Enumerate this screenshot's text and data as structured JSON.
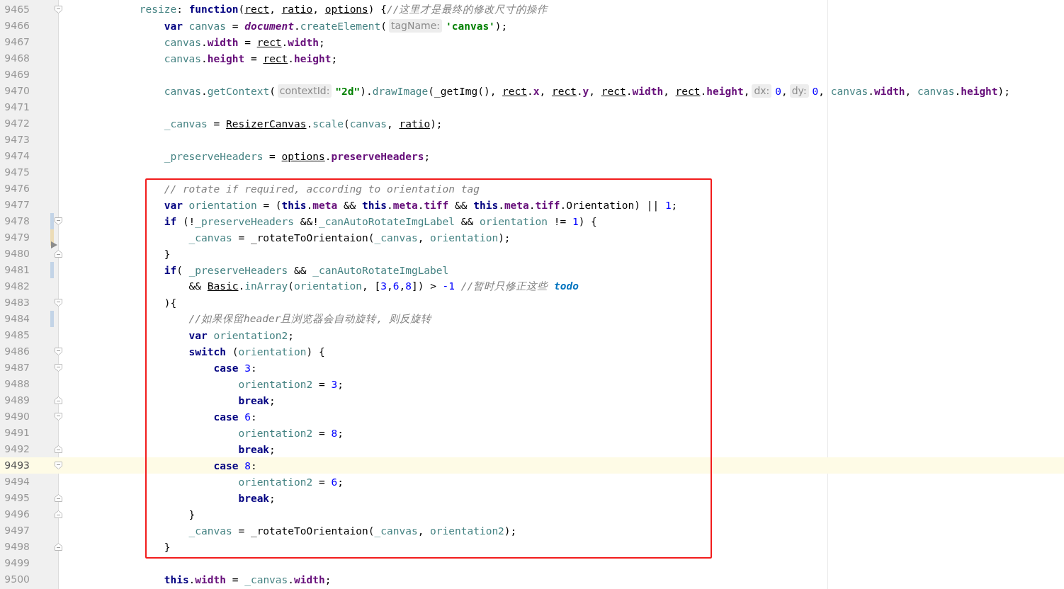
{
  "blocks": [
    {
      "kind": "plain",
      "lines": [
        {
          "number": "9465",
          "current": false,
          "marks": [
            {
              "kind": "fold_start"
            }
          ],
          "tokens": [
            {
              "kind": "field",
              "text": "            resize"
            },
            {
              "kind": "plain",
              "text": ": "
            },
            {
              "kind": "kw",
              "text": "function"
            },
            {
              "kind": "plain",
              "text": "("
            },
            {
              "kind": "ref",
              "text": "rect"
            },
            {
              "kind": "plain",
              "text": ", "
            },
            {
              "kind": "ref",
              "text": "ratio"
            },
            {
              "kind": "plain",
              "text": ", "
            },
            {
              "kind": "ref",
              "text": "options"
            },
            {
              "kind": "plain",
              "text": ") {"
            },
            {
              "kind": "comment",
              "text": "//这里才是最终的修改尺寸的操作"
            }
          ]
        },
        {
          "number": "9466",
          "current": false,
          "tokens": [
            {
              "kind": "kw",
              "text": "                var"
            },
            {
              "kind": "field",
              "text": " canvas"
            },
            {
              "kind": "plain",
              "text": " = "
            },
            {
              "kind": "global",
              "text": "document"
            },
            {
              "kind": "plain",
              "text": "."
            },
            {
              "kind": "field",
              "text": "createElement"
            },
            {
              "kind": "plain",
              "text": "("
            },
            {
              "kind": "hint",
              "text": "tagName:"
            },
            {
              "kind": "str",
              "text": "'canvas'"
            },
            {
              "kind": "plain",
              "text": ");"
            }
          ]
        },
        {
          "number": "9467",
          "current": false,
          "tokens": [
            {
              "kind": "field",
              "text": "                canvas"
            },
            {
              "kind": "plain",
              "text": "."
            },
            {
              "kind": "prop",
              "text": "width"
            },
            {
              "kind": "plain",
              "text": " = "
            },
            {
              "kind": "ref",
              "text": "rect"
            },
            {
              "kind": "plain",
              "text": "."
            },
            {
              "kind": "prop",
              "text": "width"
            },
            {
              "kind": "plain",
              "text": ";"
            }
          ]
        },
        {
          "number": "9468",
          "current": false,
          "tokens": [
            {
              "kind": "field",
              "text": "                canvas"
            },
            {
              "kind": "plain",
              "text": "."
            },
            {
              "kind": "prop",
              "text": "height"
            },
            {
              "kind": "plain",
              "text": " = "
            },
            {
              "kind": "ref",
              "text": "rect"
            },
            {
              "kind": "plain",
              "text": "."
            },
            {
              "kind": "prop",
              "text": "height"
            },
            {
              "kind": "plain",
              "text": ";"
            }
          ]
        },
        {
          "number": "9469",
          "current": false
        },
        {
          "number": "9470",
          "current": false,
          "tokens": [
            {
              "kind": "field",
              "text": "                canvas"
            },
            {
              "kind": "plain",
              "text": "."
            },
            {
              "kind": "field",
              "text": "getContext"
            },
            {
              "kind": "plain",
              "text": "("
            },
            {
              "kind": "hint",
              "text": "contextId:"
            },
            {
              "kind": "str",
              "text": "\"2d\""
            },
            {
              "kind": "plain",
              "text": ")."
            },
            {
              "kind": "field",
              "text": "drawImage"
            },
            {
              "kind": "plain",
              "text": "(_getImg(), "
            },
            {
              "kind": "ref",
              "text": "rect"
            },
            {
              "kind": "plain",
              "text": "."
            },
            {
              "kind": "prop",
              "text": "x"
            },
            {
              "kind": "plain",
              "text": ", "
            },
            {
              "kind": "ref",
              "text": "rect"
            },
            {
              "kind": "plain",
              "text": "."
            },
            {
              "kind": "prop",
              "text": "y"
            },
            {
              "kind": "plain",
              "text": ", "
            },
            {
              "kind": "ref",
              "text": "rect"
            },
            {
              "kind": "plain",
              "text": "."
            },
            {
              "kind": "prop",
              "text": "width"
            },
            {
              "kind": "plain",
              "text": ", "
            },
            {
              "kind": "ref",
              "text": "rect"
            },
            {
              "kind": "plain",
              "text": "."
            },
            {
              "kind": "prop",
              "text": "height"
            },
            {
              "kind": "plain",
              "text": ","
            },
            {
              "kind": "hint",
              "text": "dx:"
            },
            {
              "kind": "num",
              "text": "0"
            },
            {
              "kind": "plain",
              "text": ","
            },
            {
              "kind": "hint",
              "text": "dy:"
            },
            {
              "kind": "num",
              "text": "0"
            },
            {
              "kind": "plain",
              "text": ", "
            },
            {
              "kind": "field",
              "text": "canvas"
            },
            {
              "kind": "plain",
              "text": "."
            },
            {
              "kind": "prop",
              "text": "width"
            },
            {
              "kind": "plain",
              "text": ", "
            },
            {
              "kind": "field",
              "text": "canvas"
            },
            {
              "kind": "plain",
              "text": "."
            },
            {
              "kind": "prop",
              "text": "height"
            },
            {
              "kind": "plain",
              "text": ");"
            }
          ]
        },
        {
          "number": "9471",
          "current": false
        },
        {
          "number": "9472",
          "current": false,
          "tokens": [
            {
              "kind": "field",
              "text": "                _canvas"
            },
            {
              "kind": "plain",
              "text": " = "
            },
            {
              "kind": "ref",
              "text": "ResizerCanvas"
            },
            {
              "kind": "plain",
              "text": "."
            },
            {
              "kind": "field",
              "text": "scale"
            },
            {
              "kind": "plain",
              "text": "("
            },
            {
              "kind": "field",
              "text": "canvas"
            },
            {
              "kind": "plain",
              "text": ", "
            },
            {
              "kind": "ref",
              "text": "ratio"
            },
            {
              "kind": "plain",
              "text": ");"
            }
          ]
        },
        {
          "number": "9473",
          "current": false
        },
        {
          "number": "9474",
          "current": false,
          "tokens": [
            {
              "kind": "field",
              "text": "                _preserveHeaders"
            },
            {
              "kind": "plain",
              "text": " = "
            },
            {
              "kind": "ref",
              "text": "options"
            },
            {
              "kind": "plain",
              "text": "."
            },
            {
              "kind": "prop",
              "text": "preserveHeaders"
            },
            {
              "kind": "plain",
              "text": ";"
            }
          ]
        },
        {
          "number": "9475",
          "current": false
        }
      ]
    },
    {
      "kind": "boxed",
      "lines": [
        {
          "number": "9476",
          "current": false,
          "tokens": [
            {
              "kind": "comment",
              "text": "                // rotate if required, according to orientation tag"
            }
          ]
        },
        {
          "number": "9477",
          "current": false,
          "tokens": [
            {
              "kind": "kw",
              "text": "                var"
            },
            {
              "kind": "field",
              "text": " orientation"
            },
            {
              "kind": "plain",
              "text": " = ("
            },
            {
              "kind": "kw",
              "text": "this"
            },
            {
              "kind": "plain",
              "text": "."
            },
            {
              "kind": "prop",
              "text": "meta"
            },
            {
              "kind": "plain",
              "text": " && "
            },
            {
              "kind": "kw",
              "text": "this"
            },
            {
              "kind": "plain",
              "text": "."
            },
            {
              "kind": "prop",
              "text": "meta"
            },
            {
              "kind": "plain",
              "text": "."
            },
            {
              "kind": "prop",
              "text": "tiff"
            },
            {
              "kind": "plain",
              "text": " && "
            },
            {
              "kind": "kw",
              "text": "this"
            },
            {
              "kind": "plain",
              "text": "."
            },
            {
              "kind": "prop",
              "text": "meta"
            },
            {
              "kind": "plain",
              "text": "."
            },
            {
              "kind": "prop",
              "text": "tiff"
            },
            {
              "kind": "plain",
              "text": ".Orientation) || "
            },
            {
              "kind": "num",
              "text": "1"
            },
            {
              "kind": "plain",
              "text": ";"
            }
          ]
        },
        {
          "number": "9478",
          "current": false,
          "marks": [
            {
              "kind": "fold_start"
            },
            {
              "kind": "added"
            }
          ],
          "tokens": [
            {
              "kind": "kw",
              "text": "                if"
            },
            {
              "kind": "plain",
              "text": " (!"
            },
            {
              "kind": "field",
              "text": "_preserveHeaders"
            },
            {
              "kind": "plain",
              "text": " &&!"
            },
            {
              "kind": "field",
              "text": "_canAutoRotateImgLabel"
            },
            {
              "kind": "plain",
              "text": " && "
            },
            {
              "kind": "field",
              "text": "orientation"
            },
            {
              "kind": "plain",
              "text": " != "
            },
            {
              "kind": "num",
              "text": "1"
            },
            {
              "kind": "plain",
              "text": ") {"
            }
          ]
        },
        {
          "number": "9479",
          "current": false,
          "marks": [
            {
              "kind": "modified"
            }
          ],
          "tokens": [
            {
              "kind": "field",
              "text": "                    _canvas"
            },
            {
              "kind": "plain",
              "text": " = _rotateToOrientaion("
            },
            {
              "kind": "field",
              "text": "_canvas"
            },
            {
              "kind": "plain",
              "text": ", "
            },
            {
              "kind": "field",
              "text": "orientation"
            },
            {
              "kind": "plain",
              "text": ");"
            }
          ]
        },
        {
          "number": "9480",
          "current": false,
          "marks": [
            {
              "kind": "fold_end"
            },
            {
              "kind": "deleted"
            }
          ],
          "tokens": [
            {
              "kind": "plain",
              "text": "                }"
            }
          ]
        },
        {
          "number": "9481",
          "current": false,
          "marks": [
            {
              "kind": "added"
            }
          ],
          "tokens": [
            {
              "kind": "kw",
              "text": "                if"
            },
            {
              "kind": "plain",
              "text": "( "
            },
            {
              "kind": "field",
              "text": "_preserveHeaders"
            },
            {
              "kind": "plain",
              "text": " && "
            },
            {
              "kind": "field",
              "text": "_canAutoRotateImgLabel"
            }
          ]
        },
        {
          "number": "9482",
          "current": false,
          "tokens": [
            {
              "kind": "plain",
              "text": "                    && "
            },
            {
              "kind": "ref",
              "text": "Basic"
            },
            {
              "kind": "plain",
              "text": "."
            },
            {
              "kind": "field",
              "text": "inArray"
            },
            {
              "kind": "plain",
              "text": "("
            },
            {
              "kind": "field",
              "text": "orientation"
            },
            {
              "kind": "plain",
              "text": ", ["
            },
            {
              "kind": "num",
              "text": "3"
            },
            {
              "kind": "plain",
              "text": ","
            },
            {
              "kind": "num",
              "text": "6"
            },
            {
              "kind": "plain",
              "text": ","
            },
            {
              "kind": "num",
              "text": "8"
            },
            {
              "kind": "plain",
              "text": "]) > "
            },
            {
              "kind": "num",
              "text": "-1"
            },
            {
              "kind": "comment",
              "text": " //暂时只修正这些 "
            },
            {
              "kind": "todo",
              "text": "todo"
            }
          ]
        },
        {
          "number": "9483",
          "current": false,
          "marks": [
            {
              "kind": "fold_start"
            }
          ],
          "tokens": [
            {
              "kind": "plain",
              "text": "                ){"
            }
          ]
        },
        {
          "number": "9484",
          "current": false,
          "marks": [
            {
              "kind": "added"
            }
          ],
          "tokens": [
            {
              "kind": "comment",
              "text": "                    //如果保留header且浏览器会自动旋转, 则反旋转"
            }
          ]
        },
        {
          "number": "9485",
          "current": false,
          "tokens": [
            {
              "kind": "kw",
              "text": "                    var"
            },
            {
              "kind": "field",
              "text": " orientation2"
            },
            {
              "kind": "plain",
              "text": ";"
            }
          ]
        },
        {
          "number": "9486",
          "current": false,
          "marks": [
            {
              "kind": "fold_start"
            }
          ],
          "tokens": [
            {
              "kind": "kw",
              "text": "                    switch"
            },
            {
              "kind": "plain",
              "text": " ("
            },
            {
              "kind": "field",
              "text": "orientation"
            },
            {
              "kind": "plain",
              "text": ") {"
            }
          ]
        },
        {
          "number": "9487",
          "current": false,
          "marks": [
            {
              "kind": "fold_start"
            }
          ],
          "tokens": [
            {
              "kind": "kw",
              "text": "                        case"
            },
            {
              "kind": "num",
              "text": " 3"
            },
            {
              "kind": "plain",
              "text": ":"
            }
          ]
        },
        {
          "number": "9488",
          "current": false,
          "tokens": [
            {
              "kind": "field",
              "text": "                            orientation2"
            },
            {
              "kind": "plain",
              "text": " = "
            },
            {
              "kind": "num",
              "text": "3"
            },
            {
              "kind": "plain",
              "text": ";"
            }
          ]
        },
        {
          "number": "9489",
          "current": false,
          "marks": [
            {
              "kind": "fold_end"
            }
          ],
          "tokens": [
            {
              "kind": "kw",
              "text": "                            break"
            },
            {
              "kind": "plain",
              "text": ";"
            }
          ]
        },
        {
          "number": "9490",
          "current": false,
          "marks": [
            {
              "kind": "fold_start"
            }
          ],
          "tokens": [
            {
              "kind": "kw",
              "text": "                        case"
            },
            {
              "kind": "num",
              "text": " 6"
            },
            {
              "kind": "plain",
              "text": ":"
            }
          ]
        },
        {
          "number": "9491",
          "current": false,
          "tokens": [
            {
              "kind": "field",
              "text": "                            orientation2"
            },
            {
              "kind": "plain",
              "text": " = "
            },
            {
              "kind": "num",
              "text": "8"
            },
            {
              "kind": "plain",
              "text": ";"
            }
          ]
        },
        {
          "number": "9492",
          "current": false,
          "marks": [
            {
              "kind": "fold_end"
            }
          ],
          "tokens": [
            {
              "kind": "kw",
              "text": "                            break"
            },
            {
              "kind": "plain",
              "text": ";"
            }
          ]
        },
        {
          "number": "9493",
          "current": true,
          "marks": [
            {
              "kind": "fold_start"
            }
          ],
          "tokens": [
            {
              "kind": "kw",
              "text": "                        case"
            },
            {
              "kind": "num",
              "text": " 8"
            },
            {
              "kind": "plain",
              "text": ":"
            }
          ]
        },
        {
          "number": "9494",
          "current": false,
          "tokens": [
            {
              "kind": "field",
              "text": "                            orientation2"
            },
            {
              "kind": "plain",
              "text": " = "
            },
            {
              "kind": "num",
              "text": "6"
            },
            {
              "kind": "plain",
              "text": ";"
            }
          ]
        },
        {
          "number": "9495",
          "current": false,
          "marks": [
            {
              "kind": "fold_end"
            }
          ],
          "tokens": [
            {
              "kind": "kw",
              "text": "                            break"
            },
            {
              "kind": "plain",
              "text": ";"
            }
          ]
        },
        {
          "number": "9496",
          "current": false,
          "marks": [
            {
              "kind": "fold_end"
            }
          ],
          "tokens": [
            {
              "kind": "plain",
              "text": "                    }"
            }
          ]
        },
        {
          "number": "9497",
          "current": false,
          "tokens": [
            {
              "kind": "field",
              "text": "                    _canvas"
            },
            {
              "kind": "plain",
              "text": " = _rotateToOrientaion("
            },
            {
              "kind": "field",
              "text": "_canvas"
            },
            {
              "kind": "plain",
              "text": ", "
            },
            {
              "kind": "field",
              "text": "orientation2"
            },
            {
              "kind": "plain",
              "text": ");"
            }
          ]
        },
        {
          "number": "9498",
          "current": false,
          "marks": [
            {
              "kind": "fold_end"
            }
          ],
          "tokens": [
            {
              "kind": "plain",
              "text": "                }"
            }
          ]
        }
      ]
    },
    {
      "kind": "plain",
      "lines": [
        {
          "number": "9499",
          "current": false
        },
        {
          "number": "9500",
          "current": false,
          "tokens": [
            {
              "kind": "kw",
              "text": "                this"
            },
            {
              "kind": "plain",
              "text": "."
            },
            {
              "kind": "prop",
              "text": "width"
            },
            {
              "kind": "plain",
              "text": " = "
            },
            {
              "kind": "field",
              "text": "_canvas"
            },
            {
              "kind": "plain",
              "text": "."
            },
            {
              "kind": "prop",
              "text": "width"
            },
            {
              "kind": "plain",
              "text": ";"
            }
          ]
        }
      ]
    }
  ]
}
